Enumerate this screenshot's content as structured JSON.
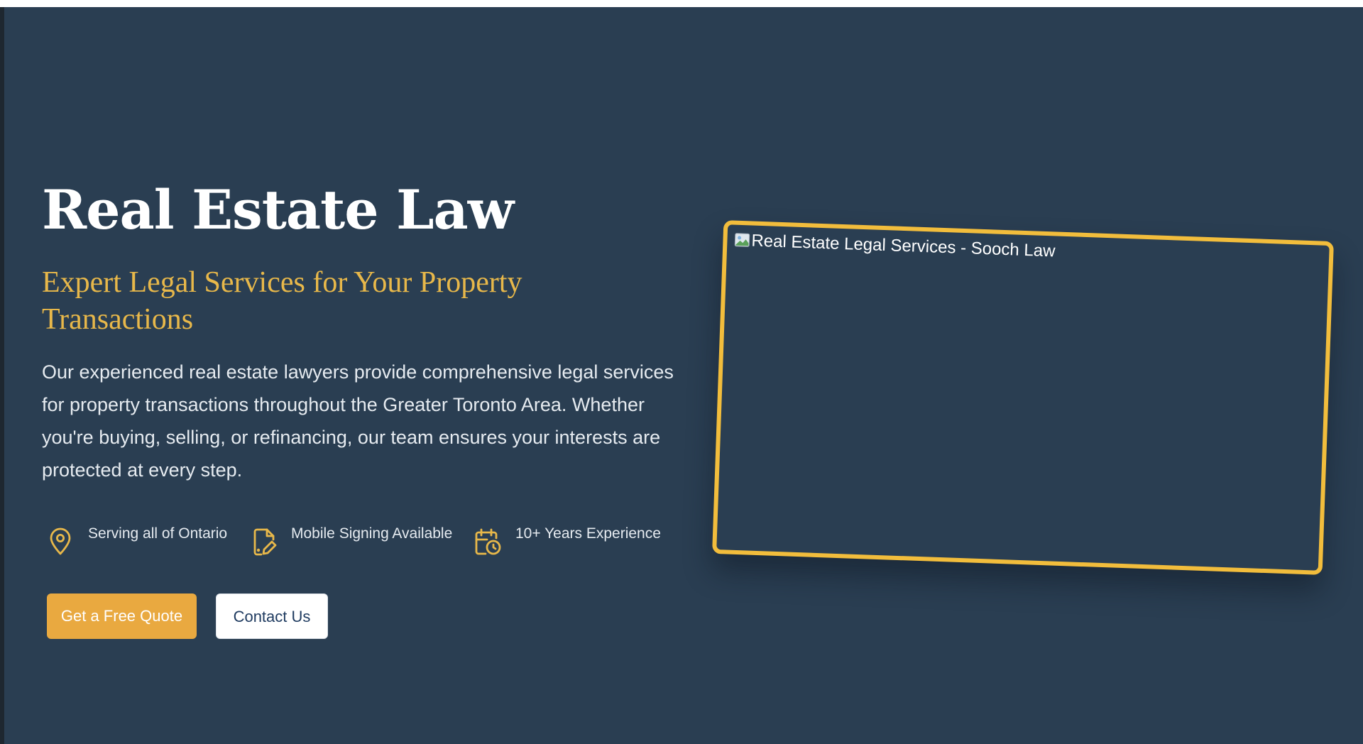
{
  "hero": {
    "title": "Real Estate Law",
    "subtitle": "Expert Legal Services for Your Property Transactions",
    "description": "Our experienced real estate lawyers provide comprehensive legal services for property transactions throughout the Greater Toronto Area. Whether you're buying, selling, or refinancing, our team ensures your interests are protected at every step.",
    "features": [
      {
        "icon": "map-pin-icon",
        "label": "Serving all of Ontario"
      },
      {
        "icon": "document-edit-icon",
        "label": "Mobile Signing Available"
      },
      {
        "icon": "calendar-clock-icon",
        "label": "10+ Years Experience"
      }
    ],
    "buttons": {
      "quote_label": "Get a Free Quote",
      "contact_label": "Contact Us"
    },
    "image": {
      "alt": "Real Estate Legal Services - Sooch Law",
      "icon": "broken-image-icon"
    }
  },
  "colors": {
    "background": "#2a3e52",
    "accent": "#e8b84a",
    "button_primary": "#e9a940",
    "button_secondary_text": "#1e3a5f",
    "frame_border": "#f2bd3c"
  }
}
